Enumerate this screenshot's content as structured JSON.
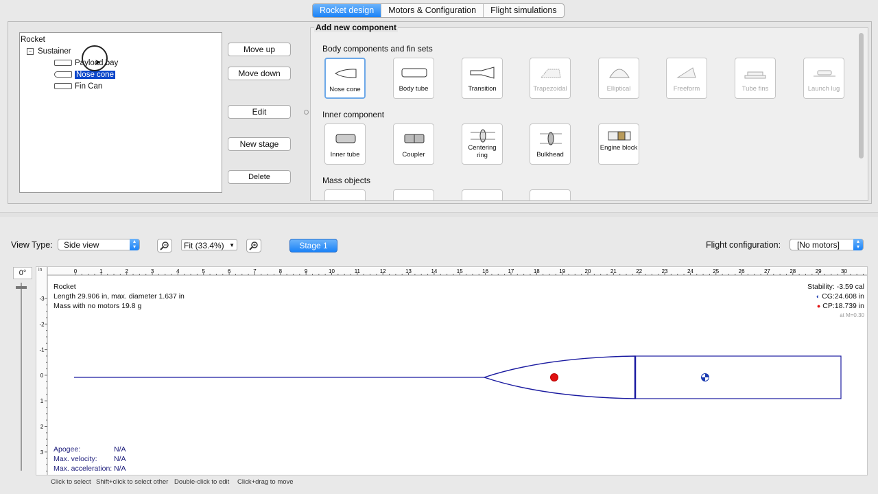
{
  "tabs": [
    {
      "label": "Rocket design",
      "active": true
    },
    {
      "label": "Motors & Configuration",
      "active": false
    },
    {
      "label": "Flight simulations",
      "active": false
    }
  ],
  "tree": {
    "root": "Rocket",
    "stage": "Sustainer",
    "items": [
      {
        "label": "Payload bay",
        "selected": false
      },
      {
        "label": "Nose cone",
        "selected": true
      },
      {
        "label": "Fin Can",
        "selected": false
      }
    ]
  },
  "actions": {
    "move_up": "Move up",
    "move_down": "Move down",
    "edit": "Edit",
    "new_stage": "New stage",
    "delete": "Delete"
  },
  "add_panel": {
    "title": "Add new component",
    "body_section": "Body components and fin sets",
    "body_items": [
      {
        "label": "Nose cone",
        "icon": "nose-cone-icon",
        "enabled": true
      },
      {
        "label": "Body tube",
        "icon": "body-tube-icon",
        "enabled": true
      },
      {
        "label": "Transition",
        "icon": "transition-icon",
        "enabled": true
      },
      {
        "label": "Trapezoidal",
        "icon": "trapezoidal-fin-icon",
        "enabled": false
      },
      {
        "label": "Elliptical",
        "icon": "elliptical-fin-icon",
        "enabled": false
      },
      {
        "label": "Freeform",
        "icon": "freeform-fin-icon",
        "enabled": false
      },
      {
        "label": "Tube fins",
        "icon": "tube-fins-icon",
        "enabled": false
      },
      {
        "label": "Launch lug",
        "icon": "launch-lug-icon",
        "enabled": false
      }
    ],
    "inner_section": "Inner component",
    "inner_items": [
      {
        "label": "Inner tube",
        "icon": "inner-tube-icon"
      },
      {
        "label": "Coupler",
        "icon": "coupler-icon"
      },
      {
        "label": "Centering ring",
        "icon": "centering-ring-icon"
      },
      {
        "label": "Bulkhead",
        "icon": "bulkhead-icon"
      },
      {
        "label": "Engine block",
        "icon": "engine-block-icon"
      }
    ],
    "mass_section": "Mass objects"
  },
  "view": {
    "view_type_label": "View Type:",
    "view_type_value": "Side view",
    "zoom_value": "Fit (33.4%)",
    "stage_button": "Stage 1",
    "flight_config_label": "Flight configuration:",
    "flight_config_value": "[No motors]",
    "rotation": "0°",
    "unit": "in"
  },
  "ruler": {
    "x_ticks": [
      "0",
      "1",
      "2",
      "3",
      "4",
      "5",
      "6",
      "7",
      "8",
      "9",
      "10",
      "11",
      "12",
      "13",
      "14",
      "15",
      "16",
      "17",
      "18",
      "19",
      "20",
      "21",
      "22",
      "23",
      "24",
      "25",
      "26",
      "27",
      "28",
      "29",
      "30"
    ],
    "y_ticks": [
      "-3",
      "-2",
      "-1",
      "0",
      "1",
      "2",
      "3"
    ]
  },
  "rocket_info": {
    "name": "Rocket",
    "length_line": "Length 29.906 in, max. diameter 1.637 in",
    "mass_line": "Mass with no motors 19.8 g",
    "stability": "Stability: -3.59 cal",
    "cg": "CG:24.608 in",
    "cp": "CP:18.739 in",
    "mach": "at M=0.30"
  },
  "flight": [
    {
      "label": "Apogee:",
      "value": "N/A"
    },
    {
      "label": "Max. velocity:",
      "value": "N/A"
    },
    {
      "label": "Max. acceleration:",
      "value": "N/A"
    }
  ],
  "hints": [
    "Click to select",
    "Shift+click to select other",
    "Double-click to edit",
    "Click+drag to move"
  ],
  "colors": {
    "accent": "#1a82f7",
    "outline": "#1a1aa0",
    "cp": "#e01010",
    "cg": "#1a3ab0"
  }
}
